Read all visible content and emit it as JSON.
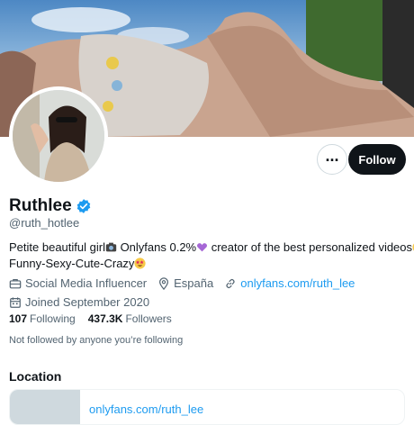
{
  "profile": {
    "name": "Ruthlee",
    "handle": "@ruth_hotlee",
    "bio_line1_a": "Petite beautiful girl",
    "bio_line1_b": " Onlyfans 0.2%",
    "bio_line1_c": " creator of the best personalized videos",
    "bio_line2": "Funny-Sexy-Cute-Crazy",
    "category": "Social Media Influencer",
    "location": "España",
    "website": "onlyfans.com/ruth_lee",
    "joined": "Joined September 2020",
    "following_count": "107",
    "following_label": "Following",
    "followers_count": "437.3K",
    "followers_label": "Followers",
    "not_followed_text": "Not followed by anyone you’re following"
  },
  "buttons": {
    "more_label": "...",
    "follow_label": "Follow"
  },
  "location_section": {
    "title": "Location",
    "card_link": "onlyfans.com/ruth_lee"
  },
  "colors": {
    "accent": "#1d9bf0",
    "text_primary": "#0f1419",
    "text_secondary": "#536471",
    "button_dark": "#0f1419",
    "verified_badge": "#1d9bf0"
  },
  "icons": {
    "verified": "verified-badge-icon",
    "more": "more-dots-icon",
    "category": "briefcase-icon",
    "location": "location-pin-icon",
    "website": "link-icon",
    "joined": "calendar-icon",
    "bio_emoji_1": "camera-emoji-icon",
    "bio_emoji_2": "purple-heart-emoji-icon",
    "bio_emoji_3": "star-struck-emoji-icon",
    "bio_emoji_4": "star-struck-emoji-icon"
  }
}
